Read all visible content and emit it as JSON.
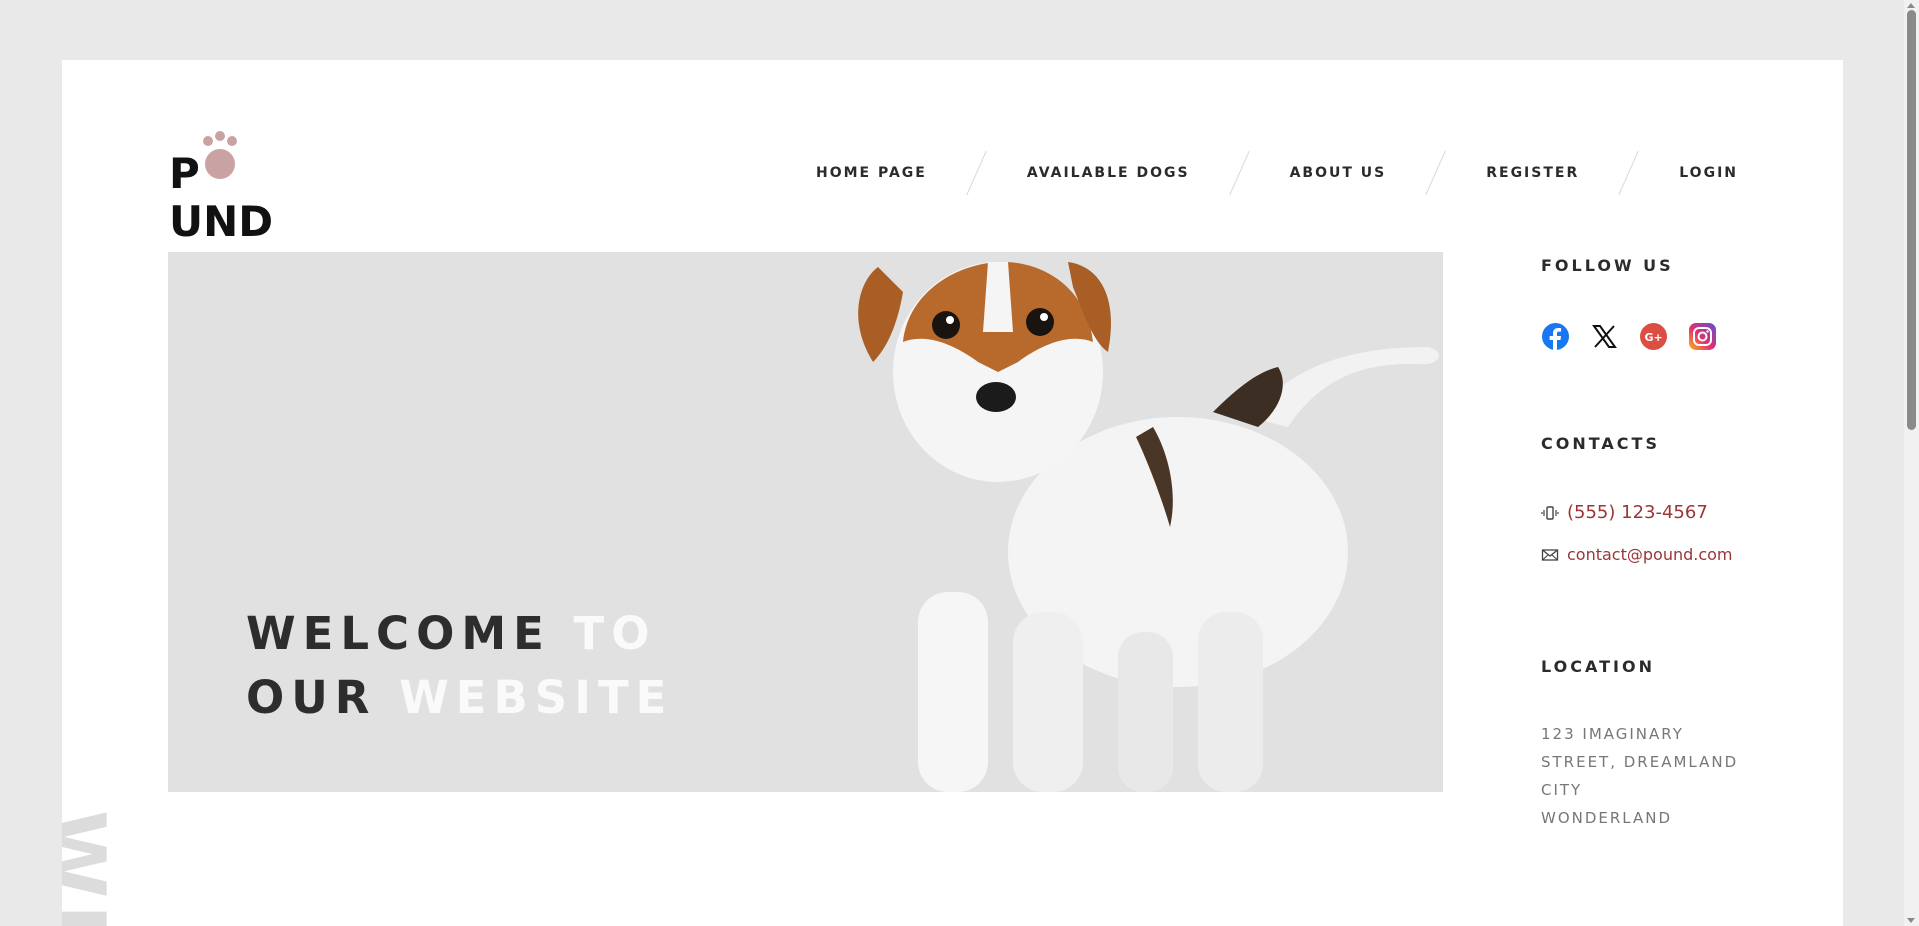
{
  "brand": {
    "logo_text": "POUND"
  },
  "nav": {
    "items": [
      "HOME PAGE",
      "AVAILABLE DOGS",
      "ABOUT US",
      "REGISTER",
      "LOGIN"
    ]
  },
  "hero": {
    "line1_dark": "WELCOME",
    "line1_light": "TO",
    "line2_dark": "OUR",
    "line2_light": "WEBSITE"
  },
  "sidebar": {
    "follow_heading": "FOLLOW US",
    "social_icons": [
      "facebook-icon",
      "x-icon",
      "google-plus-icon",
      "instagram-icon"
    ],
    "contacts_heading": "CONTACTS",
    "phone": "(555) 123-4567",
    "email": "contact@pound.com",
    "location_heading": "LOCATION",
    "address_lines": [
      "123 IMAGINARY",
      "STREET, DREAMLAND",
      "CITY",
      "WONDERLAND"
    ]
  },
  "decor": {
    "vertical_text": "WI"
  },
  "colors": {
    "page_bg": "#e9e9e9",
    "hero_bg": "#e1e1e1",
    "link": "#9a3538",
    "logo_paw": "#c9a3a3"
  }
}
